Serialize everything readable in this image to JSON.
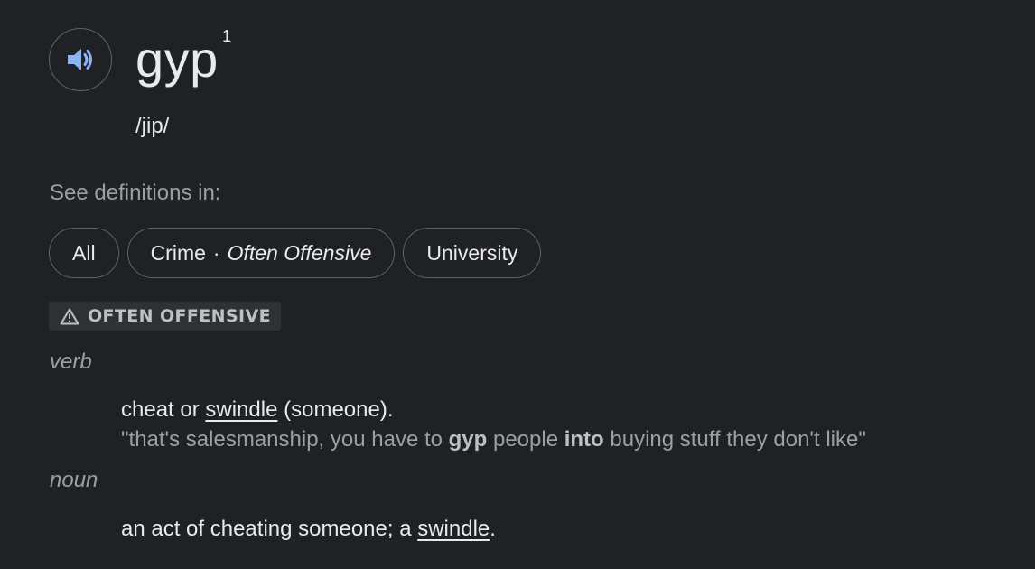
{
  "entry": {
    "word": "gyp",
    "homograph_number": "1",
    "phonetic": "/jip/",
    "speaker_icon": "volume-up-icon"
  },
  "see_definitions": {
    "label": "See definitions in:",
    "chips": [
      {
        "label": "All"
      },
      {
        "label": "Crime",
        "separator": "·",
        "qualifier": "Often Offensive"
      },
      {
        "label": "University"
      }
    ]
  },
  "warning": {
    "icon": "warning-triangle-icon",
    "label": "OFTEN OFFENSIVE"
  },
  "senses": [
    {
      "part_of_speech": "verb",
      "definition": {
        "before": "cheat or ",
        "link": "swindle",
        "after": " (someone)."
      },
      "example": {
        "part1": "\"that's salesmanship, you have to ",
        "bold1": "gyp",
        "part2": " people ",
        "bold2": "into",
        "part3": " buying stuff they don't like\""
      }
    },
    {
      "part_of_speech": "noun",
      "definition": {
        "before": "an act of cheating someone; a ",
        "link": "swindle",
        "after": "."
      }
    }
  ],
  "colors": {
    "background": "#202124",
    "text": "#e8eaed",
    "secondary_text": "#9aa0a6",
    "border": "#5f6368",
    "speaker_accent": "#8ab4f8",
    "badge_bg": "#303134"
  }
}
